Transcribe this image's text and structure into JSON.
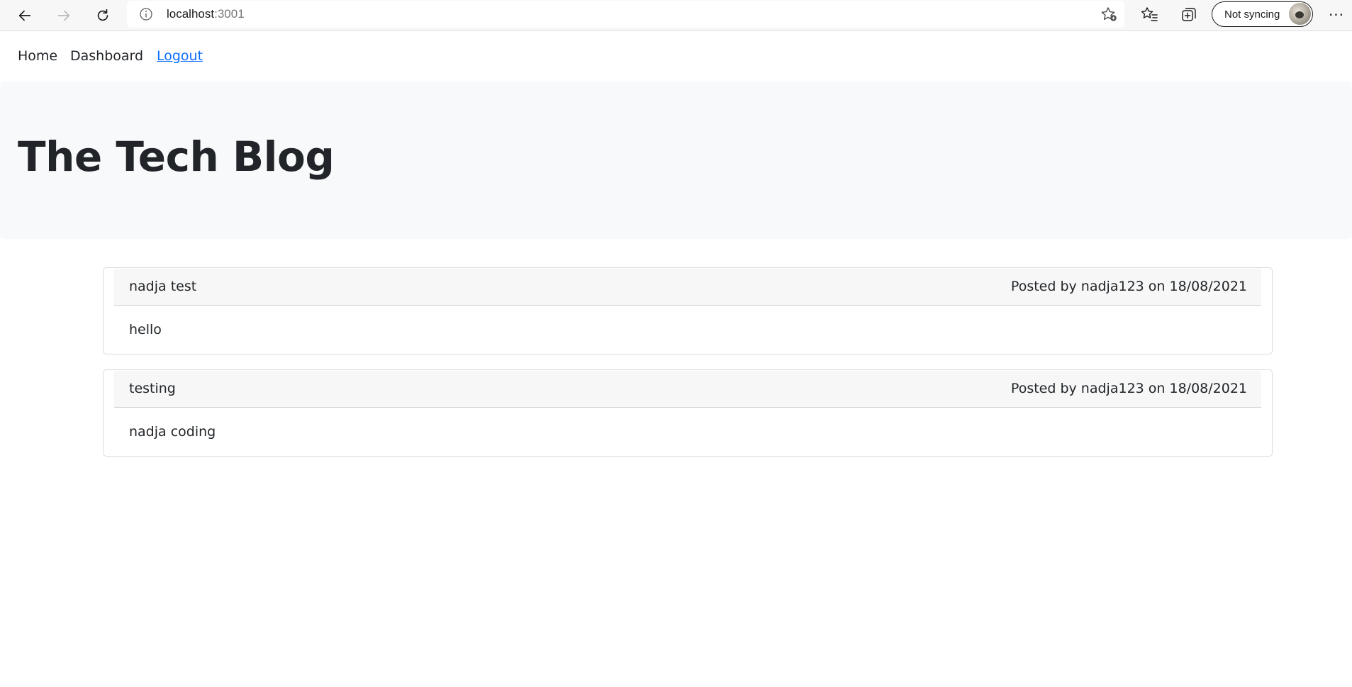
{
  "browser": {
    "url_host": "localhost",
    "url_port": ":3001",
    "sync_label": "Not syncing",
    "more_label": "···",
    "icons": {
      "back": "back-arrow-icon",
      "forward": "forward-arrow-icon",
      "reload": "reload-icon",
      "info": "info-icon",
      "favorite_add": "star-add-icon",
      "favorites": "favorites-list-icon",
      "collections": "collections-icon",
      "more": "more-dots-icon"
    }
  },
  "nav": {
    "home": "Home",
    "dashboard": "Dashboard",
    "logout": "Logout"
  },
  "hero": {
    "title": "The Tech Blog"
  },
  "posts": [
    {
      "title": "nadja test",
      "meta": "Posted by nadja123 on 18/08/2021",
      "body": "hello"
    },
    {
      "title": "testing",
      "meta": "Posted by nadja123 on 18/08/2021",
      "body": "nadja coding"
    }
  ],
  "colors": {
    "link": "#0d6efd",
    "text": "#212529",
    "jumbotron_bg": "#f8f9fa",
    "card_header_bg": "#f7f7f7"
  }
}
